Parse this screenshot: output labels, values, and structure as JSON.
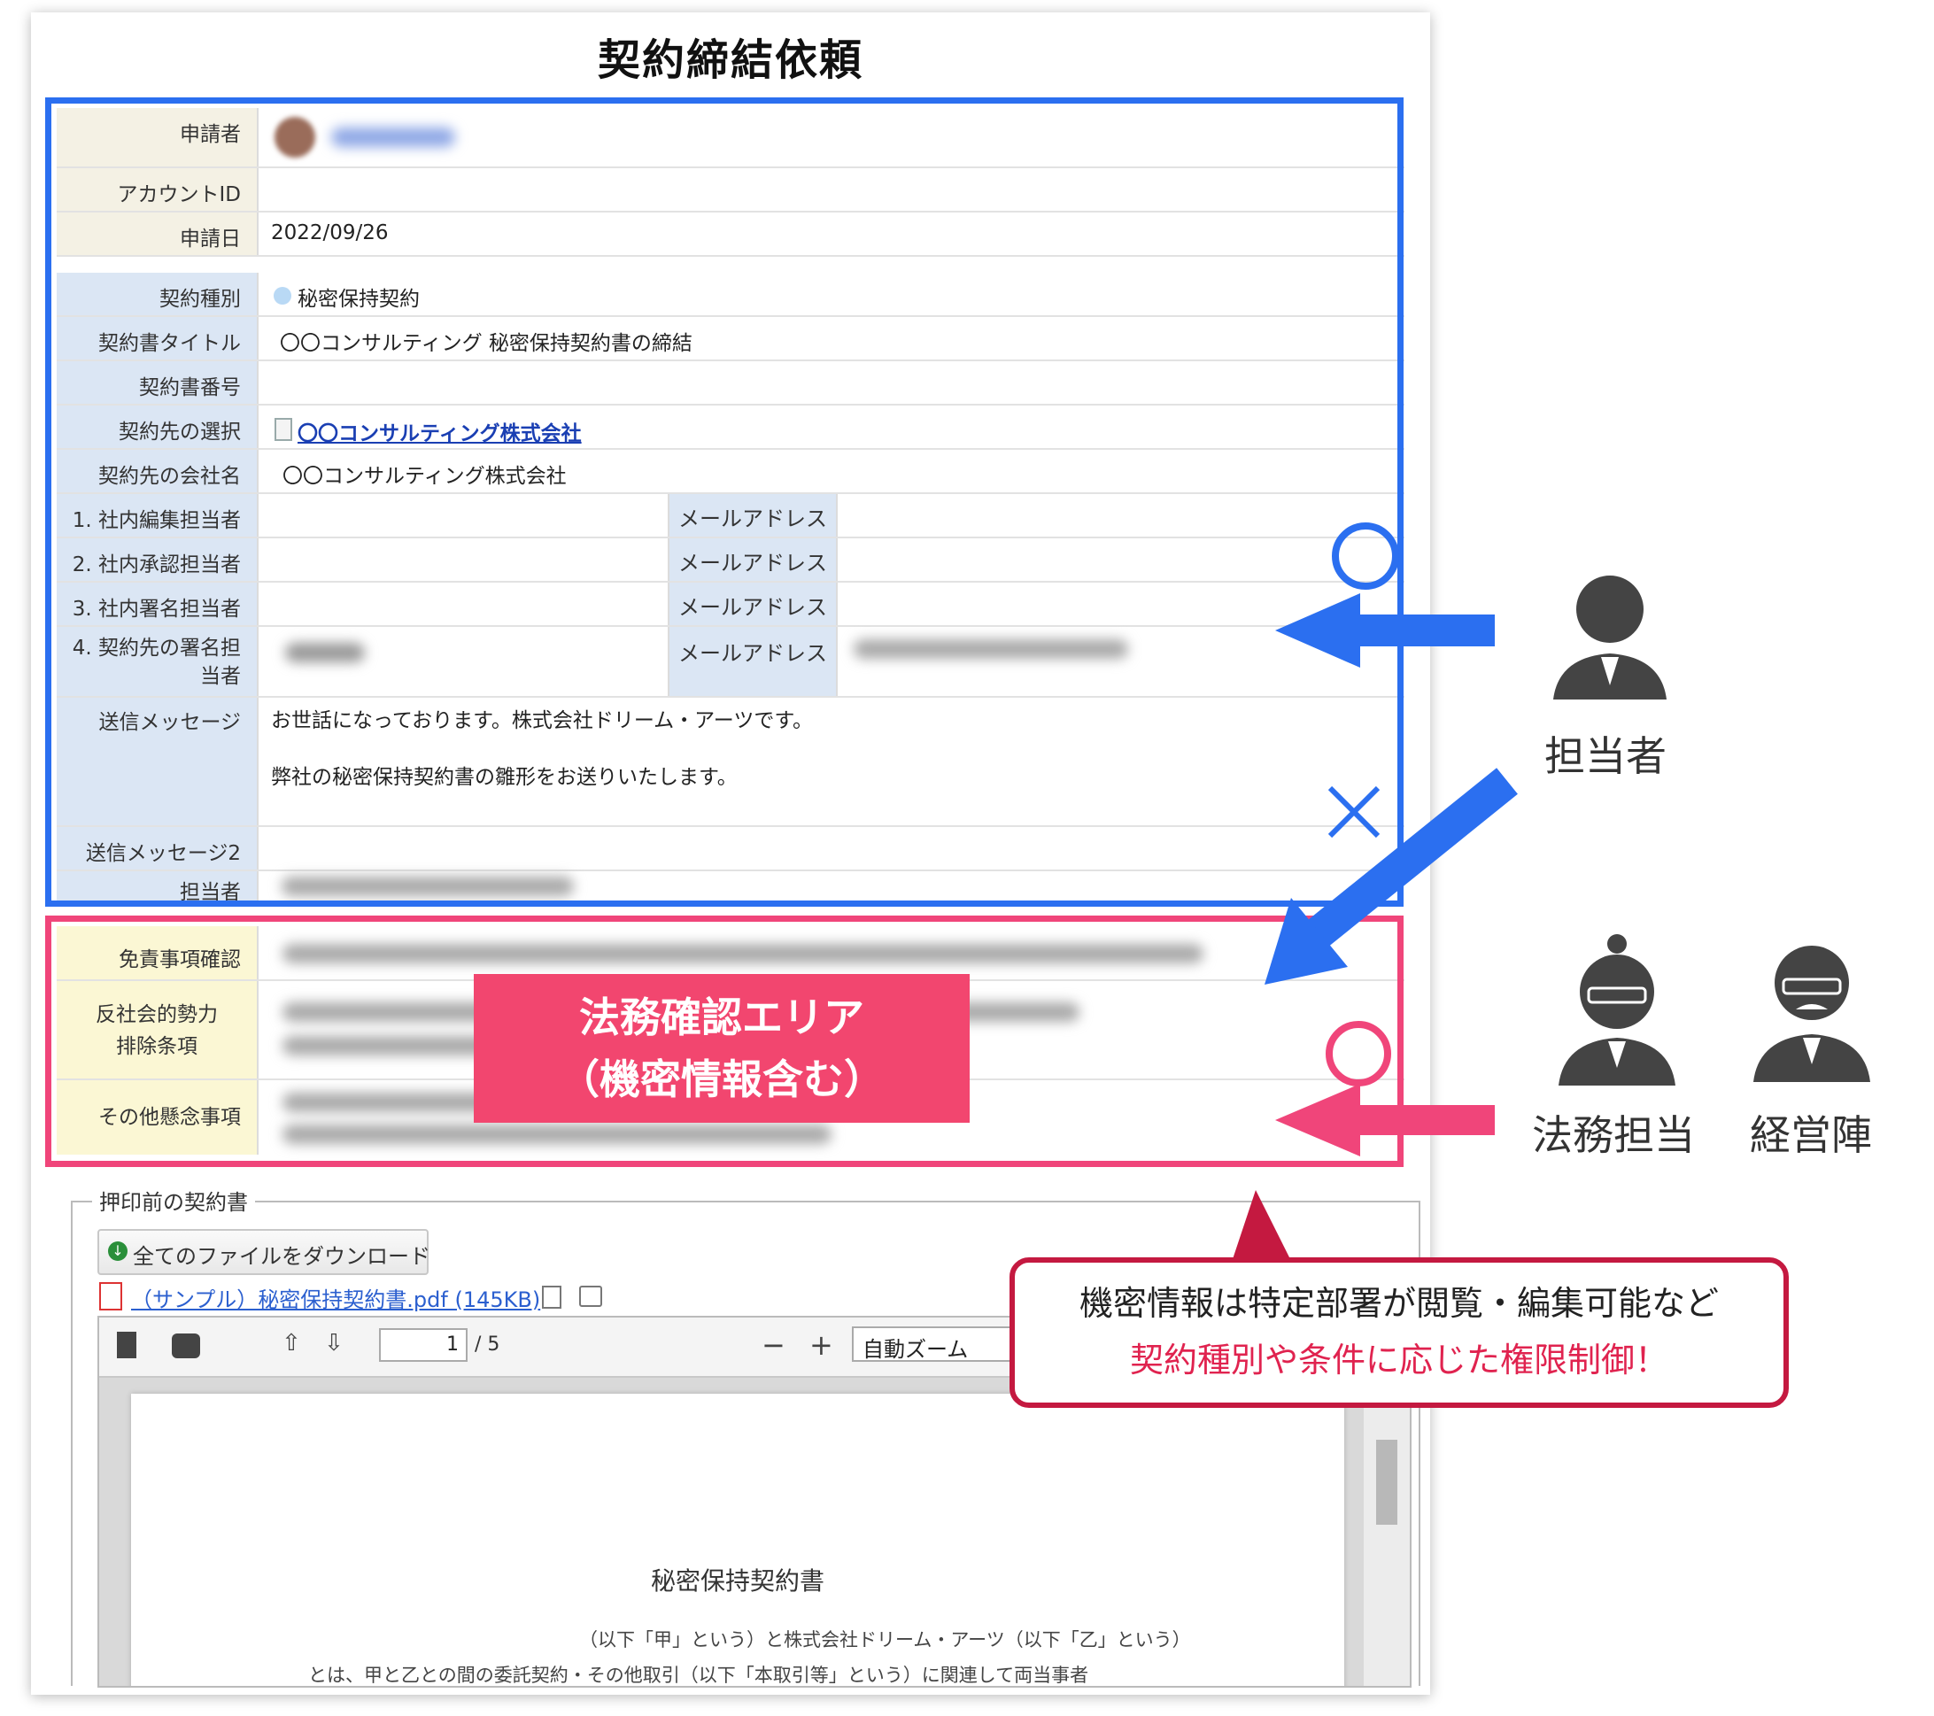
{
  "page": {
    "title": "契約締結依頼"
  },
  "applicant": {
    "label_applicant": "申請者",
    "label_account_id": "アカウントID",
    "label_date": "申請日",
    "date": "2022/09/26"
  },
  "contract": {
    "label_type": "契約種別",
    "type": "秘密保持契約",
    "label_title": "契約書タイトル",
    "title": "〇〇コンサルティング 秘密保持契約書の締結",
    "label_number": "契約書番号",
    "label_partner_select": "契約先の選択",
    "partner_link": "〇〇コンサルティング株式会社",
    "label_partner_name": "契約先の会社名",
    "partner_name": "〇〇コンサルティング株式会社",
    "label_editor": "1. 社内編集担当者",
    "label_approver": "2. 社内承認担当者",
    "label_signer": "3. 社内署名担当者",
    "label_partner_signer_1": "4. 契約先の署名担",
    "label_partner_signer_2": "当者",
    "email_label": "メールアドレス",
    "label_message": "送信メッセージ",
    "message_line1": "お世話になっております。株式会社ドリーム・アーツです。",
    "message_line2": "弊社の秘密保持契約書の雛形をお送りいたします。",
    "label_message2": "送信メッセージ2",
    "label_staff": "担当者"
  },
  "legal": {
    "label_disclaimer": "免責事項確認",
    "label_antisocial_1": "反社会的勢力",
    "label_antisocial_2": "排除条項",
    "label_other": "その他懸念事項",
    "overlay_line1": "法務確認エリア",
    "overlay_line2": "（機密情報含む）"
  },
  "attachment": {
    "legend": "押印前の契約書",
    "download_all": "全てのファイルをダウンロード",
    "file_name": "（サンプル）秘密保持契約書.pdf (145KB)",
    "page_current": "1",
    "page_total": "/ 5",
    "zoom": "自動ズーム",
    "doc_title": "秘密保持契約書",
    "doc_line1": "（以下「甲」という）と株式会社ドリーム・アーツ（以下「乙」という）",
    "doc_line2": "とは、甲と乙との間の委託契約・その他取引（以下「本取引等」という）に関連して両当事者"
  },
  "annotations": {
    "circle_mark": "○",
    "cross_mark": "×",
    "role_staff": "担当者",
    "role_legal": "法務担当",
    "role_management": "経営陣",
    "callout_line1": "機密情報は特定部署が閲覧・編集可能など",
    "callout_line2": "契約種別や条件に応じた権限制御！",
    "colors": {
      "blue": "#2b6ff0",
      "pink": "#f0457a",
      "callout_border": "#c41940",
      "callout_accent": "#e0234f"
    }
  }
}
